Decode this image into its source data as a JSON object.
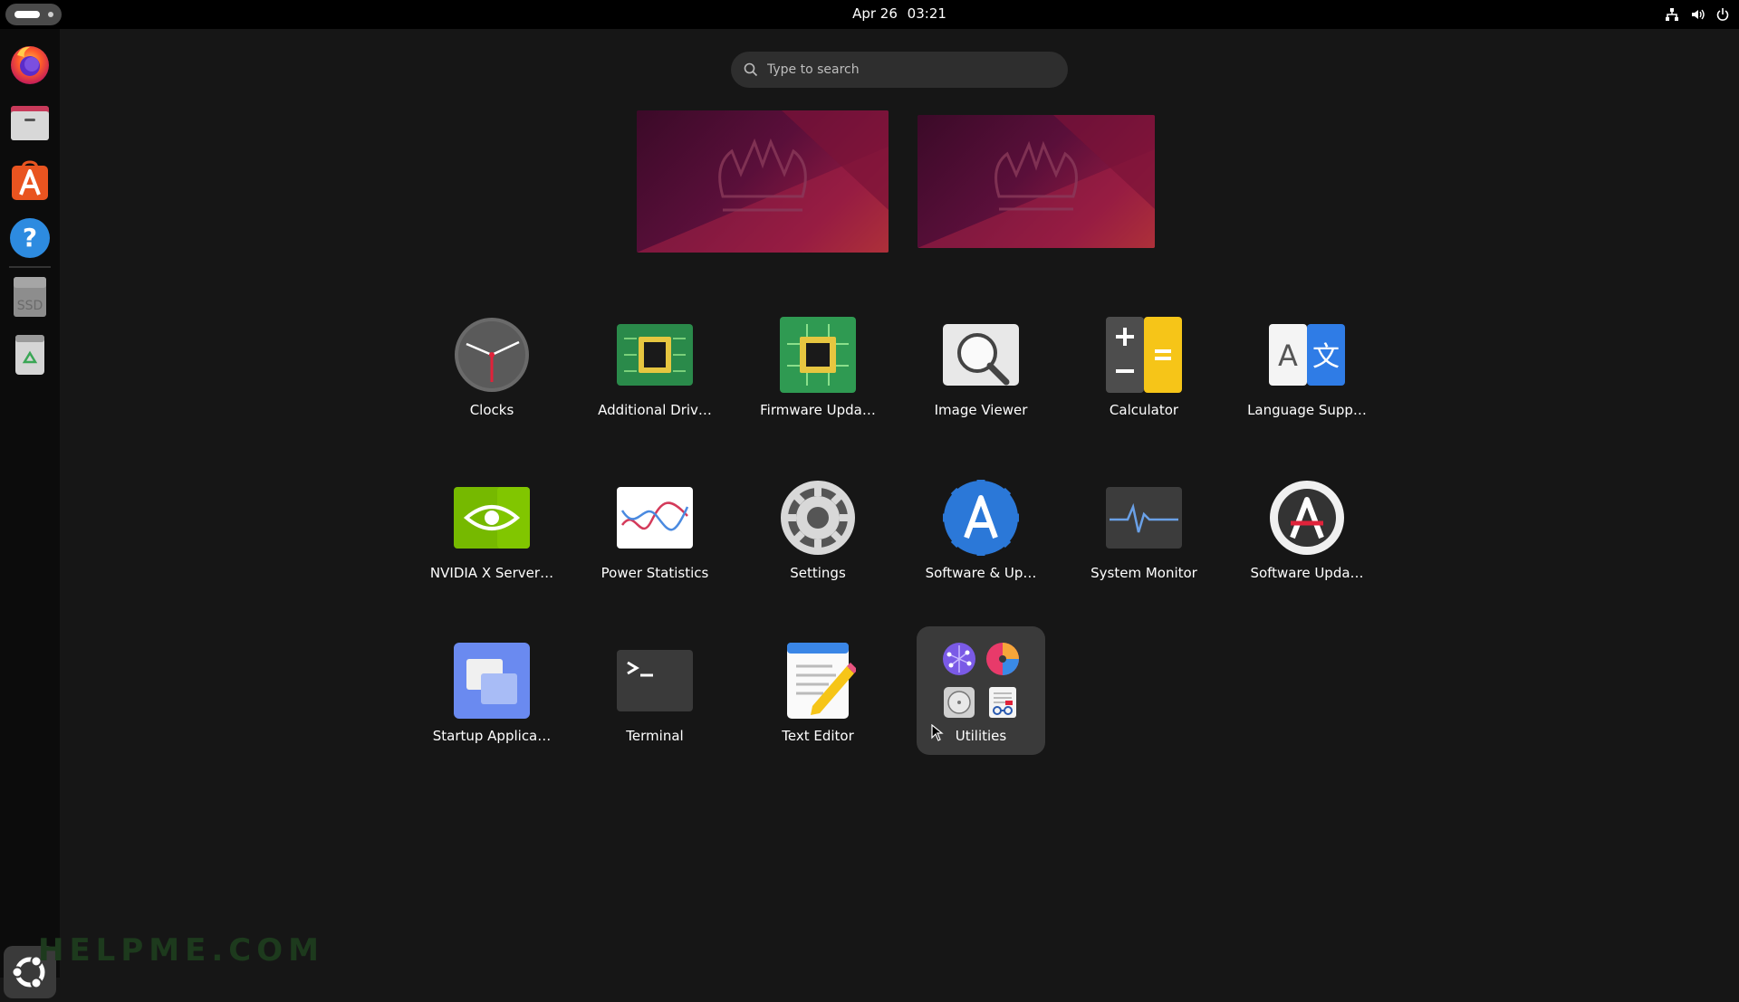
{
  "topbar": {
    "date": "Apr 26",
    "time": "03:21",
    "tray_icons": [
      "network-icon",
      "volume-icon",
      "power-icon"
    ]
  },
  "dock": {
    "items": [
      {
        "name": "firefox",
        "icon": "firefox-icon"
      },
      {
        "name": "files",
        "icon": "files-icon"
      },
      {
        "name": "app-center",
        "icon": "app-center-icon"
      },
      {
        "name": "help",
        "icon": "help-icon"
      },
      {
        "name": "ssd-drive",
        "icon": "ssd-drive-icon",
        "text": "SSD"
      },
      {
        "name": "trash",
        "icon": "trash-icon"
      }
    ],
    "show_apps_icon": "ubuntu-logo-icon"
  },
  "search": {
    "placeholder": "Type to search"
  },
  "apps": [
    {
      "label": "Clocks",
      "icon": "clock-icon"
    },
    {
      "label": "Additional Driv…",
      "icon": "chip-icon"
    },
    {
      "label": "Firmware Upda…",
      "icon": "chip-icon"
    },
    {
      "label": "Image Viewer",
      "icon": "magnifier-icon"
    },
    {
      "label": "Calculator",
      "icon": "calculator-icon"
    },
    {
      "label": "Language Supp…",
      "icon": "language-icon"
    },
    {
      "label": "NVIDIA X Server…",
      "icon": "nvidia-icon"
    },
    {
      "label": "Power Statistics",
      "icon": "power-statistics-icon"
    },
    {
      "label": "Settings",
      "icon": "gear-icon"
    },
    {
      "label": "Software & Up…",
      "icon": "software-sources-icon"
    },
    {
      "label": "System Monitor",
      "icon": "system-monitor-icon"
    },
    {
      "label": "Software Upda…",
      "icon": "software-updater-icon"
    },
    {
      "label": "Startup Applica…",
      "icon": "startup-apps-icon"
    },
    {
      "label": "Terminal",
      "icon": "terminal-icon"
    },
    {
      "label": "Text Editor",
      "icon": "text-editor-icon"
    }
  ],
  "folder": {
    "label": "Utilities",
    "mini_icons": [
      "network-graph-icon",
      "disk-usage-icon",
      "disks-icon",
      "document-viewer-icon"
    ]
  },
  "colors": {
    "background": "#161616",
    "topbar": "#000000",
    "accent_orange": "#e95420",
    "folder_bg": "#3a3a3a"
  },
  "watermark": "HELPME.COM"
}
